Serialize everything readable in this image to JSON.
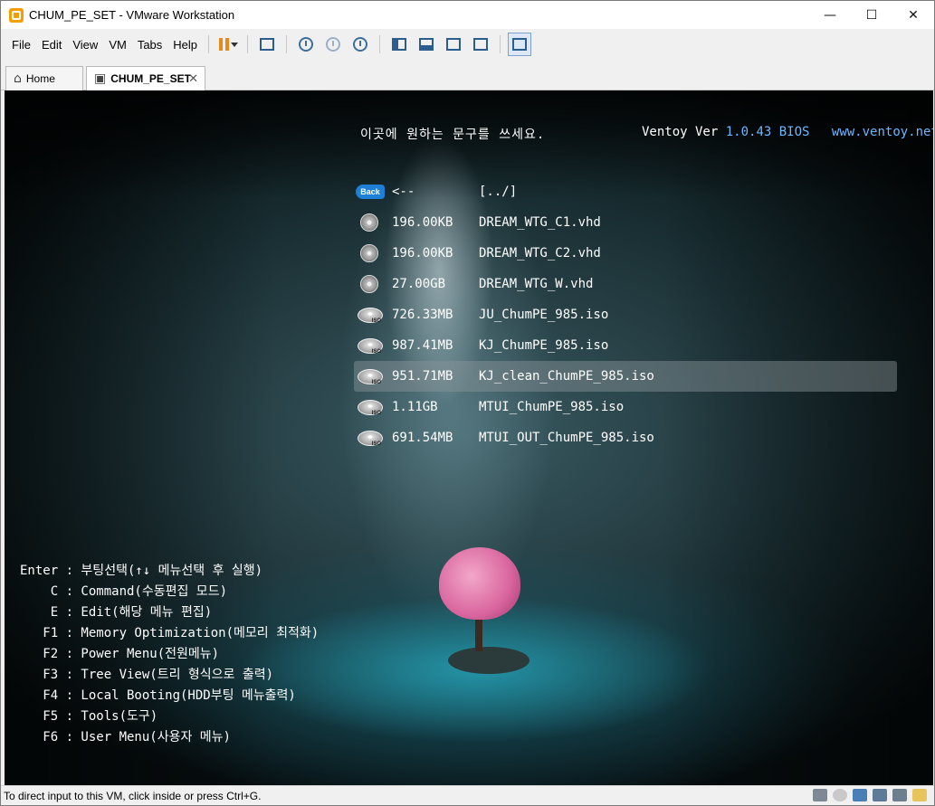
{
  "window": {
    "title": "CHUM_PE_SET - VMware Workstation"
  },
  "window_controls": {
    "minimize": "—",
    "maximize": "☐",
    "close": "✕"
  },
  "menu": [
    "File",
    "Edit",
    "View",
    "VM",
    "Tabs",
    "Help"
  ],
  "tabs": [
    {
      "label": "Home",
      "icon": "home-icon"
    },
    {
      "label": "CHUM_PE_SET",
      "icon": "vm-icon",
      "close": "✕"
    }
  ],
  "ventoy": {
    "message": "이곳에 원하는 문구를 쓰세요.",
    "ver_label": "Ventoy Ver",
    "ver_num": "1.0.43 BIOS",
    "url": "www.ventoy.net",
    "back_icon_text": "Back",
    "entries": [
      {
        "size": "<--",
        "name": "[../]",
        "icon": "back-icon"
      },
      {
        "size": "196.00KB",
        "name": "DREAM_WTG_C1.vhd",
        "icon": "disk-icon"
      },
      {
        "size": "196.00KB",
        "name": "DREAM_WTG_C2.vhd",
        "icon": "disk-icon"
      },
      {
        "size": "27.00GB",
        "name": "DREAM_WTG_W.vhd",
        "icon": "disk-icon"
      },
      {
        "size": "726.33MB",
        "name": "JU_ChumPE_985.iso",
        "icon": "iso-icon"
      },
      {
        "size": "987.41MB",
        "name": "KJ_ChumPE_985.iso",
        "icon": "iso-icon"
      },
      {
        "size": "951.71MB",
        "name": "KJ_clean_ChumPE_985.iso",
        "icon": "iso-icon"
      },
      {
        "size": "1.11GB",
        "name": "MTUI_ChumPE_985.iso",
        "icon": "iso-icon"
      },
      {
        "size": "691.54MB",
        "name": "MTUI_OUT_ChumPE_985.iso",
        "icon": "iso-icon"
      }
    ],
    "selected_index": 6,
    "help": [
      "Enter : 부팅선택(↑↓ 메뉴선택 후 실행)",
      "    C : Command(수동편집 모드)",
      "    E : Edit(해당 메뉴 편집)",
      "   F1 : Memory Optimization(메모리 최적화)",
      "   F2 : Power Menu(전원메뉴)",
      "   F3 : Tree View(트리 형식으로 출력)",
      "   F4 : Local Booting(HDD부팅 메뉴출력)",
      "   F5 : Tools(도구)",
      "   F6 : User Menu(사용자 메뉴)"
    ]
  },
  "status": {
    "text": "To direct input to this VM, click inside or press Ctrl+G."
  },
  "colors": {
    "accent": "#6fb6ff",
    "selection": "#8c969b",
    "pause": "#e8891b"
  }
}
